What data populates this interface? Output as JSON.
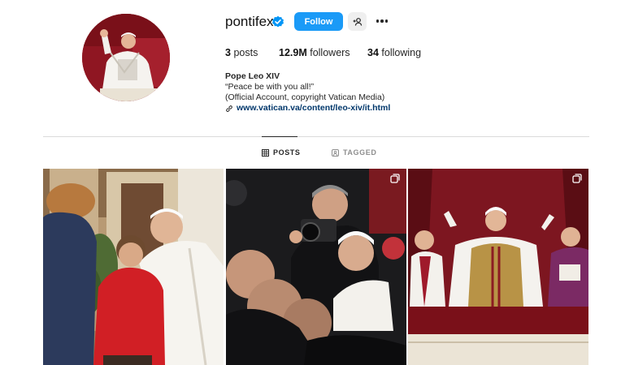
{
  "profile": {
    "username": "pontifex",
    "verified_icon": "verified-badge-icon",
    "follow_label": "Follow",
    "suggest_icon": "add-person-icon",
    "more_icon": "more-options-icon"
  },
  "stats": {
    "posts_count": "3",
    "posts_label": "posts",
    "followers_count": "12.9M",
    "followers_label": "followers",
    "following_count": "34",
    "following_label": "following"
  },
  "bio": {
    "name": "Pope Leo XIV",
    "line1": "“Peace be with you all!”",
    "line2": "(Official Account, copyright Vatican Media)",
    "link": "www.vatican.va/content/leo-xiv/it.html"
  },
  "tabs": {
    "posts": "POSTS",
    "tagged": "TAGGED"
  },
  "colors": {
    "accent": "#1a9af7",
    "link": "#00376b",
    "cardinal_red": "#8f1622"
  }
}
